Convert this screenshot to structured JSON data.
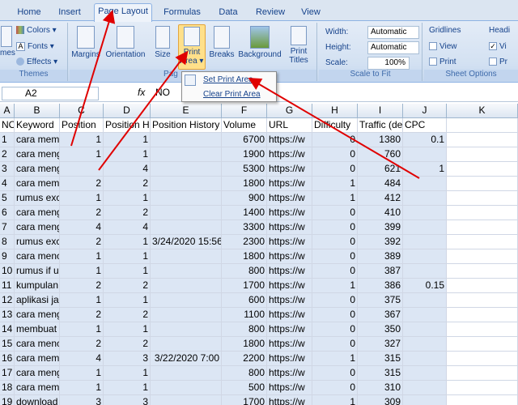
{
  "tabs": [
    "Home",
    "Insert",
    "Page Layout",
    "Formulas",
    "Data",
    "Review",
    "View"
  ],
  "ribbon": {
    "themes": {
      "label": "Themes",
      "colors": "Colors",
      "fonts": "Fonts",
      "effects": "Effects",
      "themes_btn": "mes"
    },
    "page_setup": {
      "label": "Pag",
      "margins": "Margins",
      "orientation": "Orientation",
      "size": "Size",
      "print_area_1": "Print",
      "print_area_2": "Area",
      "breaks": "Breaks",
      "background": "Background",
      "print_titles_1": "Print",
      "print_titles_2": "Titles"
    },
    "scale": {
      "label": "Scale to Fit",
      "width_label": "Width:",
      "width_val": "Automatic",
      "height_label": "Height:",
      "height_val": "Automatic",
      "scale_label": "Scale:",
      "scale_val": "100%"
    },
    "sheet": {
      "label": "Sheet Options",
      "gridlines": "Gridlines",
      "headings": "Headi",
      "view": "View",
      "print": "Print",
      "view2": "Vi",
      "print2": "Pr"
    }
  },
  "menu": {
    "set_print_area": "Set Print Area",
    "clear_print_area": "Clear Print Area"
  },
  "formula_bar": {
    "name_box": "A2",
    "fx": "fx",
    "content": "NO"
  },
  "columns": [
    "A",
    "B",
    "C",
    "D",
    "E",
    "F",
    "G",
    "H",
    "I",
    "J",
    "K"
  ],
  "header_row": [
    "NO",
    "Keyword",
    "Position",
    "Position H",
    "Position History",
    "Volume",
    "URL",
    "Difficulty",
    "Traffic (de",
    "CPC",
    ""
  ],
  "rows": [
    [
      "1",
      "cara mem",
      "1",
      "1",
      "",
      "6700",
      "https://w",
      "0",
      "1380",
      "0.1"
    ],
    [
      "2",
      "cara meng",
      "1",
      "1",
      "",
      "1900",
      "https://w",
      "0",
      "760",
      ""
    ],
    [
      "3",
      "cara meng",
      "",
      "4",
      "",
      "5300",
      "https://w",
      "0",
      "621",
      "1"
    ],
    [
      "4",
      "cara mem",
      "2",
      "2",
      "",
      "1800",
      "https://w",
      "1",
      "484",
      ""
    ],
    [
      "5",
      "rumus exc",
      "1",
      "1",
      "",
      "900",
      "https://w",
      "1",
      "412",
      ""
    ],
    [
      "6",
      "cara meng",
      "2",
      "2",
      "",
      "1400",
      "https://w",
      "0",
      "410",
      ""
    ],
    [
      "7",
      "cara meng",
      "4",
      "4",
      "",
      "3300",
      "https://w",
      "0",
      "399",
      ""
    ],
    [
      "8",
      "rumus exc",
      "2",
      "1",
      "3/24/2020 15:56",
      "2300",
      "https://w",
      "0",
      "392",
      ""
    ],
    [
      "9",
      "cara menc",
      "1",
      "1",
      "",
      "1800",
      "https://w",
      "0",
      "389",
      ""
    ],
    [
      "10",
      "rumus if u",
      "1",
      "1",
      "",
      "800",
      "https://w",
      "0",
      "387",
      ""
    ],
    [
      "11",
      "kumpulan",
      "2",
      "2",
      "",
      "1700",
      "https://w",
      "1",
      "386",
      "0.15"
    ],
    [
      "12",
      "aplikasi ja",
      "1",
      "1",
      "",
      "600",
      "https://w",
      "0",
      "375",
      ""
    ],
    [
      "13",
      "cara meng",
      "2",
      "2",
      "",
      "1100",
      "https://w",
      "0",
      "367",
      ""
    ],
    [
      "14",
      "membuat",
      "1",
      "1",
      "",
      "800",
      "https://w",
      "0",
      "350",
      ""
    ],
    [
      "15",
      "cara menc",
      "2",
      "2",
      "",
      "1800",
      "https://w",
      "0",
      "327",
      ""
    ],
    [
      "16",
      "cara mem",
      "4",
      "3",
      "3/22/2020 7:00",
      "2200",
      "https://w",
      "1",
      "315",
      ""
    ],
    [
      "17",
      "cara meng",
      "1",
      "1",
      "",
      "800",
      "https://w",
      "0",
      "315",
      ""
    ],
    [
      "18",
      "cara mem",
      "1",
      "1",
      "",
      "500",
      "https://w",
      "0",
      "310",
      ""
    ],
    [
      "19",
      "download",
      "3",
      "3",
      "",
      "1700",
      "https://w",
      "1",
      "309",
      ""
    ]
  ]
}
